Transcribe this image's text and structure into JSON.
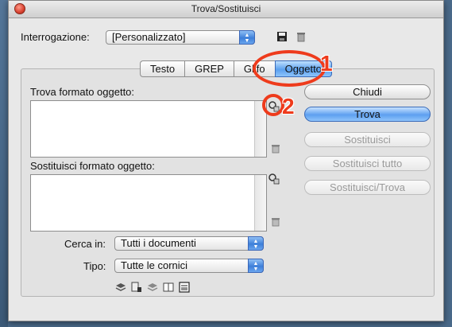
{
  "window": {
    "title": "Trova/Sostituisci"
  },
  "query": {
    "label": "Interrogazione:",
    "value": "[Personalizzato]"
  },
  "tabs": [
    {
      "label": "Testo"
    },
    {
      "label": "GREP"
    },
    {
      "label": "Glifo"
    },
    {
      "label": "Oggetto"
    }
  ],
  "find": {
    "label": "Trova formato oggetto:"
  },
  "replace": {
    "label": "Sostituisci formato oggetto:"
  },
  "buttons": {
    "close": "Chiudi",
    "find": "Trova",
    "replace": "Sostituisci",
    "replace_all": "Sostituisci tutto",
    "replace_find": "Sostituisci/Trova"
  },
  "search_in": {
    "label": "Cerca in:",
    "value": "Tutti i documenti"
  },
  "type": {
    "label": "Tipo:",
    "value": "Tutte le cornici"
  },
  "annotations": {
    "one": "1",
    "two": "2"
  },
  "colors": {
    "accent": "#5aa0ee",
    "annotation": "#ee3b1c"
  }
}
